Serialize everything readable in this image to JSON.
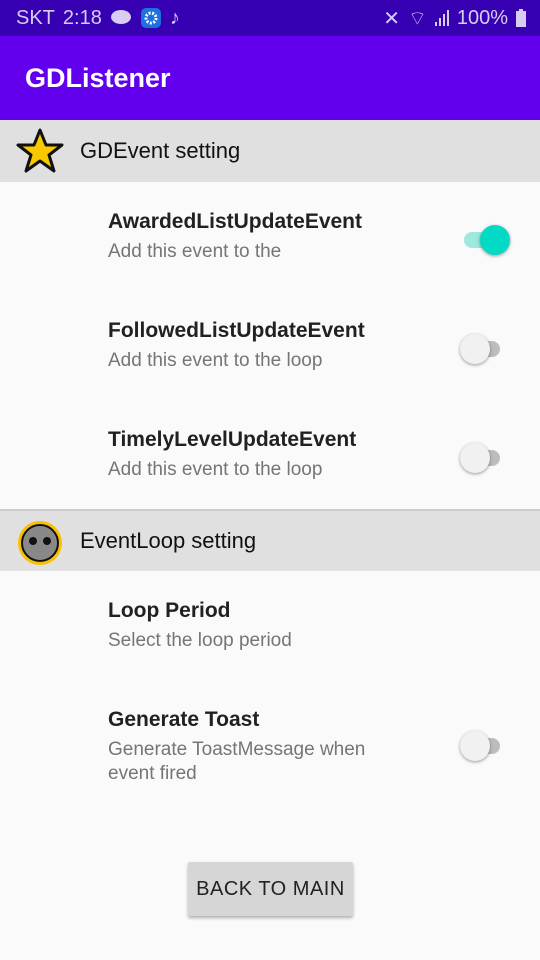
{
  "status": {
    "carrier": "SKT",
    "time": "2:18",
    "battery": "100%"
  },
  "app": {
    "title": "GDListener"
  },
  "categories": [
    {
      "title": "GDEvent setting",
      "icon": "star-icon"
    },
    {
      "title": "EventLoop setting",
      "icon": "face-icon"
    }
  ],
  "prefs": [
    {
      "title": "AwardedListUpdateEvent",
      "summary": "Add this event to the",
      "checked": true
    },
    {
      "title": "FollowedListUpdateEvent",
      "summary": "Add this event to the loop",
      "checked": false
    },
    {
      "title": "TimelyLevelUpdateEvent",
      "summary": "Add this event to the loop",
      "checked": false
    },
    {
      "title": "Loop Period",
      "summary": "Select the loop period"
    },
    {
      "title": "Generate Toast",
      "summary": "Generate ToastMessage when event fired",
      "checked": false
    }
  ],
  "button": {
    "label": "BACK TO MAIN"
  }
}
